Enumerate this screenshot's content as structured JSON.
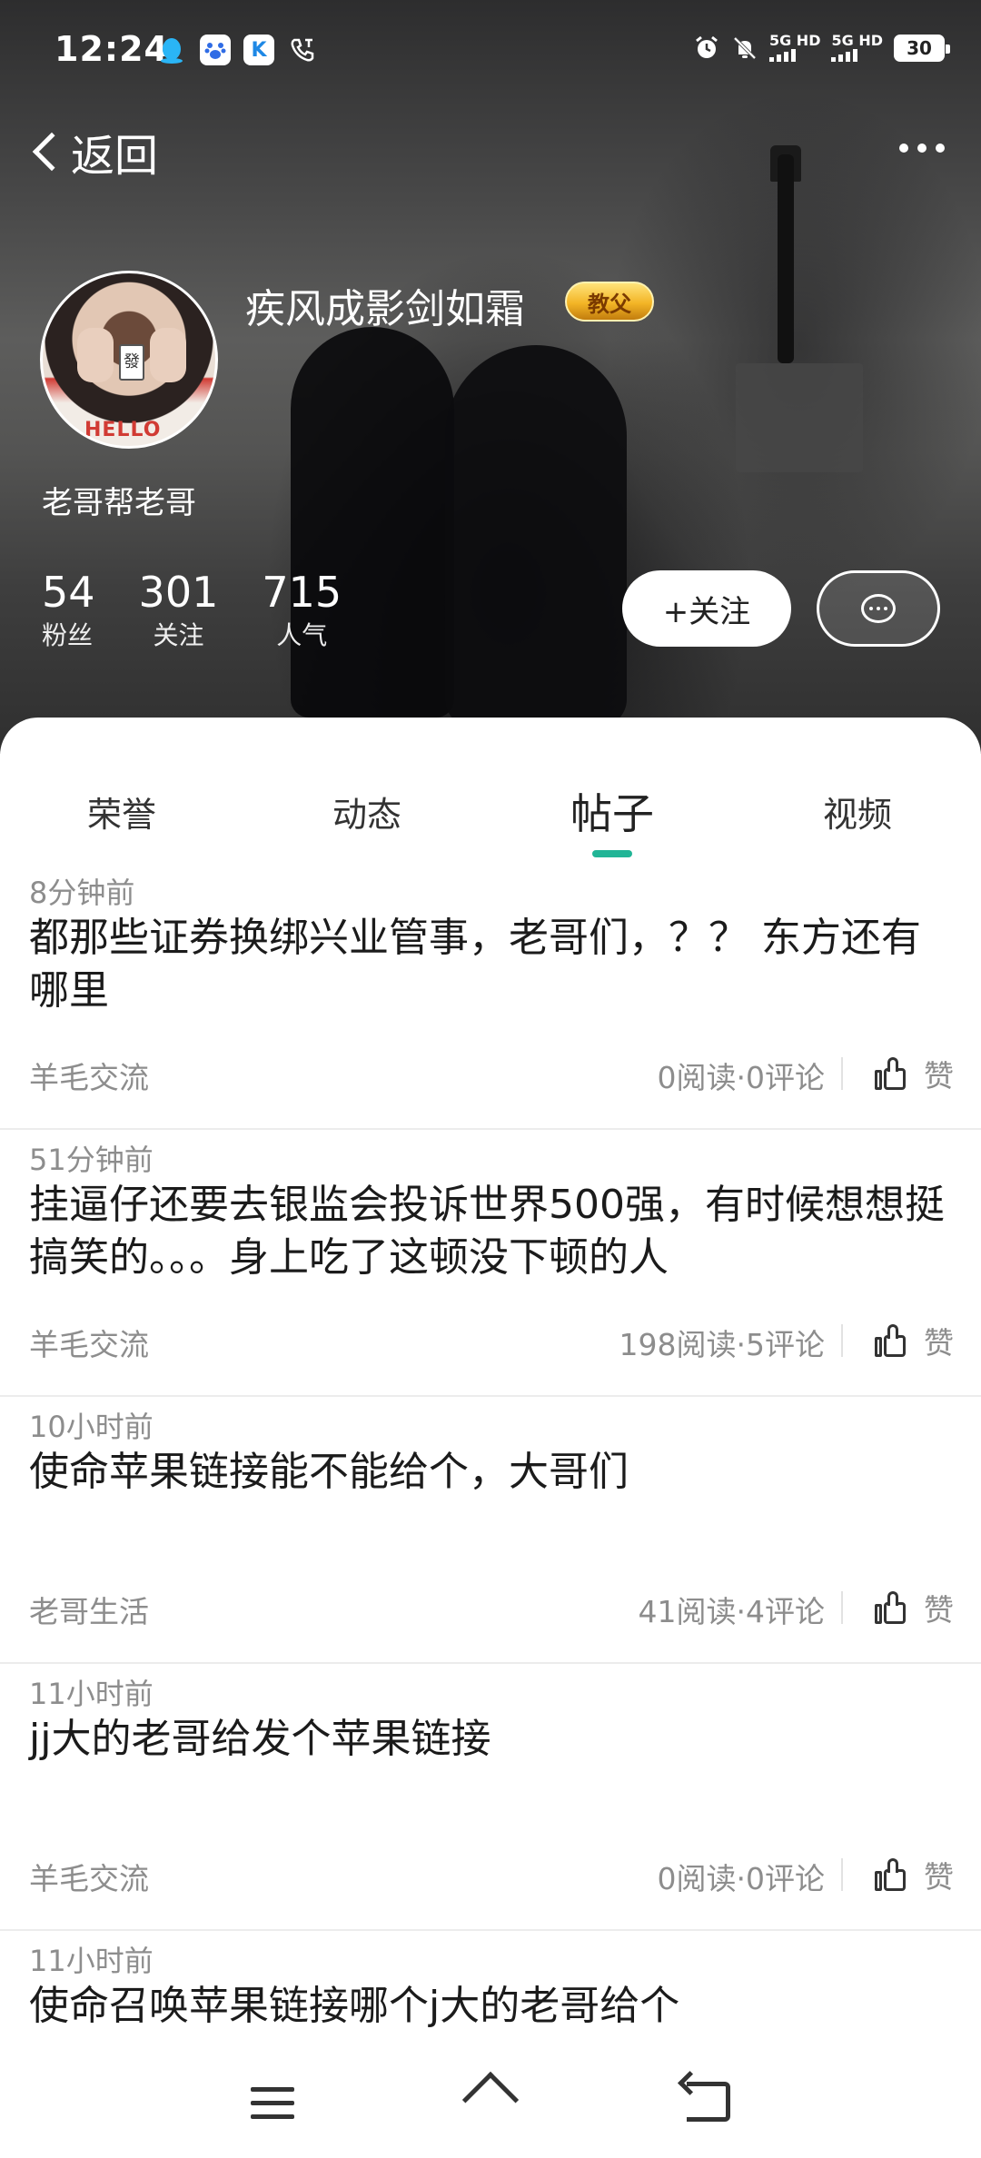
{
  "status_bar": {
    "time": "12:24",
    "network_1": "5G HD",
    "network_2": "5G HD",
    "battery": "30",
    "app_icons": [
      "qq-icon",
      "baidu-icon",
      "k-app-icon",
      "phone-call-icon"
    ]
  },
  "nav": {
    "back_label": "返回"
  },
  "profile": {
    "username": "疾风成影剑如霜",
    "badge": "教父",
    "bio": "老哥帮老哥",
    "avatar_shirt_text": "HELLO",
    "avatar_tile_char": "發",
    "stats": [
      {
        "value": "54",
        "label": "粉丝"
      },
      {
        "value": "301",
        "label": "关注"
      },
      {
        "value": "715",
        "label": "人气"
      }
    ],
    "follow_label": "+关注"
  },
  "tabs": [
    {
      "label": "荣誉",
      "active": false
    },
    {
      "label": "动态",
      "active": false
    },
    {
      "label": "帖子",
      "active": true
    },
    {
      "label": "视频",
      "active": false
    }
  ],
  "posts": [
    {
      "time": "8分钟前",
      "title": "都那些证券换绑兴业管事，老哥们，？？ 东方还有哪里",
      "category": "羊毛交流",
      "stats": "0阅读·0评论",
      "like_label": "赞"
    },
    {
      "time": "51分钟前",
      "title": "挂逼仔还要去银监会投诉世界500强，有时候想想挺搞笑的。。。身上吃了这顿没下顿的人",
      "category": "羊毛交流",
      "stats": "198阅读·5评论",
      "like_label": "赞"
    },
    {
      "time": "10小时前",
      "title": "使命苹果链接能不能给个，大哥们",
      "category": "老哥生活",
      "stats": "41阅读·4评论",
      "like_label": "赞"
    },
    {
      "time": "11小时前",
      "title": "jj大的老哥给发个苹果链接",
      "category": "羊毛交流",
      "stats": "0阅读·0评论",
      "like_label": "赞"
    },
    {
      "time": "11小时前",
      "title": "使命召唤苹果链接哪个j大的老哥给个",
      "category": "",
      "stats": "",
      "like_label": ""
    }
  ],
  "colors": {
    "accent": "#21b596",
    "badge_gold": "#f3b526"
  }
}
